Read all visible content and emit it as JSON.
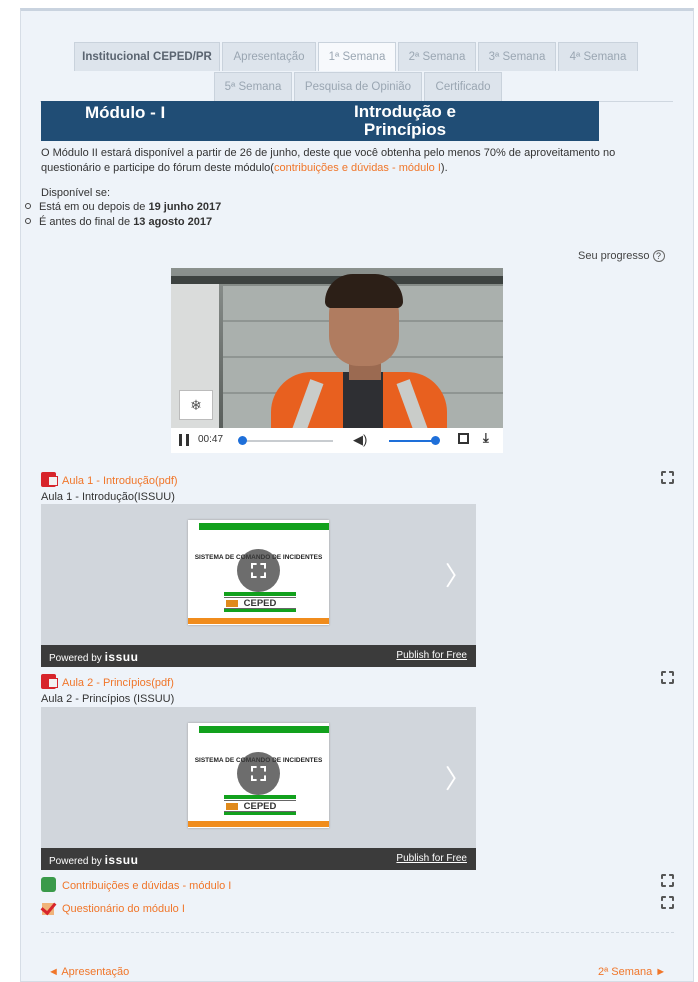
{
  "tabs": [
    "Institucional CEPED/PR",
    "Apresentação",
    "1ª Semana",
    "2ª Semana",
    "3ª Semana",
    "4ª Semana",
    "5ª Semana",
    "Pesquisa de Opinião",
    "Certificado"
  ],
  "banner": {
    "left": "Módulo - I",
    "right": "Introdução e Princípios"
  },
  "notice": {
    "text": "O Módulo II estará disponível a partir de 26 de junho, deste que você obtenha  pelo menos 70% de aproveitamento no questionário e participe do fórum deste módulo(",
    "link": "contribuições e dúvidas - módulo I",
    "tail": ")."
  },
  "availability": {
    "heading": "Disponível se:",
    "cond1_prefix": "Está em ou depois de ",
    "cond1_date": "19 junho 2017",
    "cond2_prefix": "É antes do final de ",
    "cond2_date": "13 agosto 2017"
  },
  "progress_label": "Seu progresso",
  "video": {
    "time": "00:47",
    "played": 0.03,
    "volume": 0.95
  },
  "items": {
    "aula1_pdf": "Aula 1 - Introdução(pdf)",
    "aula1_issuu": "Aula 1 - Introdução(ISSUU)",
    "aula2_pdf": "Aula 2 - Princípios(pdf)",
    "aula2_issuu": "Aula 2 - Princípios (ISSUU)",
    "forum": "Contribuições e dúvidas - módulo I",
    "quiz": "Questionário do módulo I"
  },
  "issuu": {
    "doc_title": "SISTEMA DE COMANDO DE INCIDENTES",
    "logo_text": "CEPED",
    "powered_by": "Powered by",
    "brand": "issuu",
    "publish": "Publish for Free"
  },
  "nav": {
    "prev": "◄ Apresentação",
    "next": "2ª Semana ►"
  }
}
